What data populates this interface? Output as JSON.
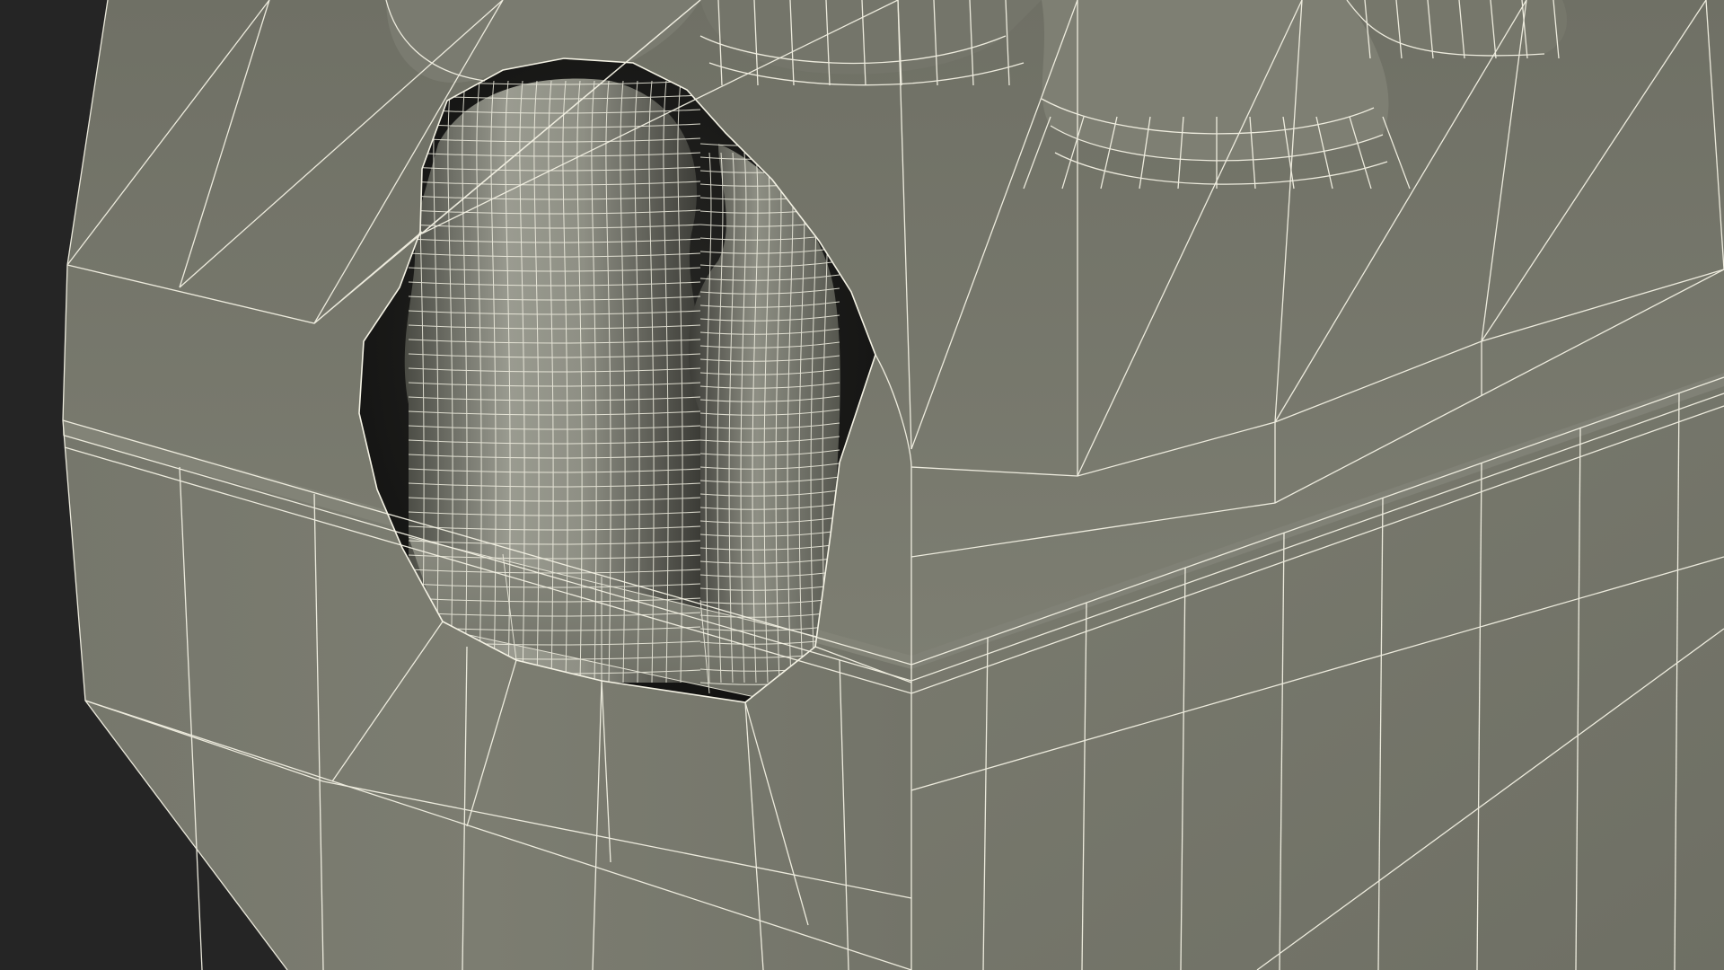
{
  "scene": {
    "subject": "wireframe-render",
    "background_color": "#252525",
    "surface_color": "#7b7c70",
    "surface_light_color": "#85867a",
    "surface_dark_color": "#6b6c61",
    "cavity_color": "#1a1a18",
    "bottle_color": "#8a8b80",
    "wire_color": "#f4f2e4"
  }
}
